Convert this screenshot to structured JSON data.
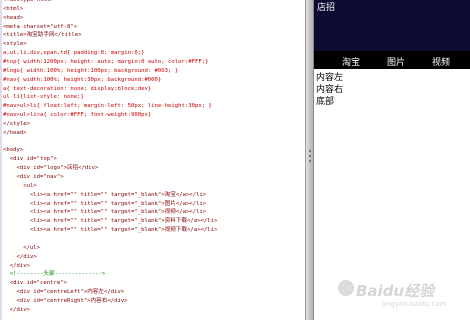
{
  "editor": {
    "lines": [
      {
        "t": "<!doctype html>",
        "c": "tag"
      },
      {
        "t": "<html>",
        "c": "tag"
      },
      {
        "t": "<head>",
        "c": "tag"
      },
      {
        "t": "<meta charset=\"utf-8\">",
        "c": "tag"
      },
      {
        "t": "<title>淘宝助手网</title>",
        "c": "tag"
      },
      {
        "t": "<style>",
        "c": "tag"
      },
      {
        "t": "a,ul,li,div,span,td{ padding:0; margin:0;}",
        "c": "css"
      },
      {
        "t": "#top{ width:1200px; height: auto; margin:0 auto; color:#FFF;}",
        "c": "css"
      },
      {
        "t": "#logo{ width:100%; height:100px; background: #003; }",
        "c": "css"
      },
      {
        "t": "#nav{ width:100%; height:30px; background:#000}",
        "c": "css"
      },
      {
        "t": "a{ text-decoration: none; display:block;dev}",
        "c": "css"
      },
      {
        "t": "ul li{list-style: none;}",
        "c": "css"
      },
      {
        "t": "#nav>ul>li{ float:left; margin-left: 50px; line-height:30px; }",
        "c": "css"
      },
      {
        "t": "#nav>ul>li>a{ color:#FFF; font-weight:900px}",
        "c": "css"
      },
      {
        "t": "</style>",
        "c": "tag"
      },
      {
        "t": "</head>",
        "c": "tag"
      },
      {
        "t": "",
        "c": ""
      },
      {
        "t": "<body>",
        "c": "tag"
      },
      {
        "t": "  <div id=\"top\">",
        "c": "tag"
      },
      {
        "t": "    <div id=\"logo\">店招</div>",
        "c": "tag"
      },
      {
        "t": "    <div id=\"nav\">",
        "c": "tag"
      },
      {
        "t": "      <ul>",
        "c": "tag"
      },
      {
        "t": "        <li><a href=\"\" title=\"\" target=\"_blank\">淘宝</a></li>",
        "c": "tag"
      },
      {
        "t": "        <li><a href=\"\" title=\"\" target=\"_blank\">图片</a></li>",
        "c": "tag"
      },
      {
        "t": "        <li><a href=\"\" title=\"\" target=\"_blank\">视频</a></li>",
        "c": "tag"
      },
      {
        "t": "        <li><a href=\"\" title=\"\" target=\"_blank\">资料下载</a></li>",
        "c": "tag"
      },
      {
        "t": "        <li><a href=\"\" title=\"\" target=\"_blank\">视频下载</a></li>",
        "c": "tag"
      },
      {
        "t": "",
        "c": ""
      },
      {
        "t": "      </ul>",
        "c": "tag"
      },
      {
        "t": "    </div>",
        "c": "tag"
      },
      {
        "t": "  </div>",
        "c": "tag"
      },
      {
        "t": "  <!--------头部-------------->",
        "c": "cmt"
      },
      {
        "t": "  <div id=\"centre\">",
        "c": "tag"
      },
      {
        "t": "    <div id=\"centreLeft\">内容左</div>",
        "c": "tag"
      },
      {
        "t": "    <div id=\"centreRight\">内容右</div>",
        "c": "tag"
      },
      {
        "t": "  </div>",
        "c": "tag"
      }
    ]
  },
  "preview": {
    "logo": "店招",
    "nav_items": [
      "淘宝",
      "图片",
      "视频"
    ],
    "texts": [
      "内容左",
      "内容右",
      "底部"
    ]
  },
  "watermark": {
    "text": "Baidu经验",
    "sub": "jingyan.baidu.com"
  }
}
